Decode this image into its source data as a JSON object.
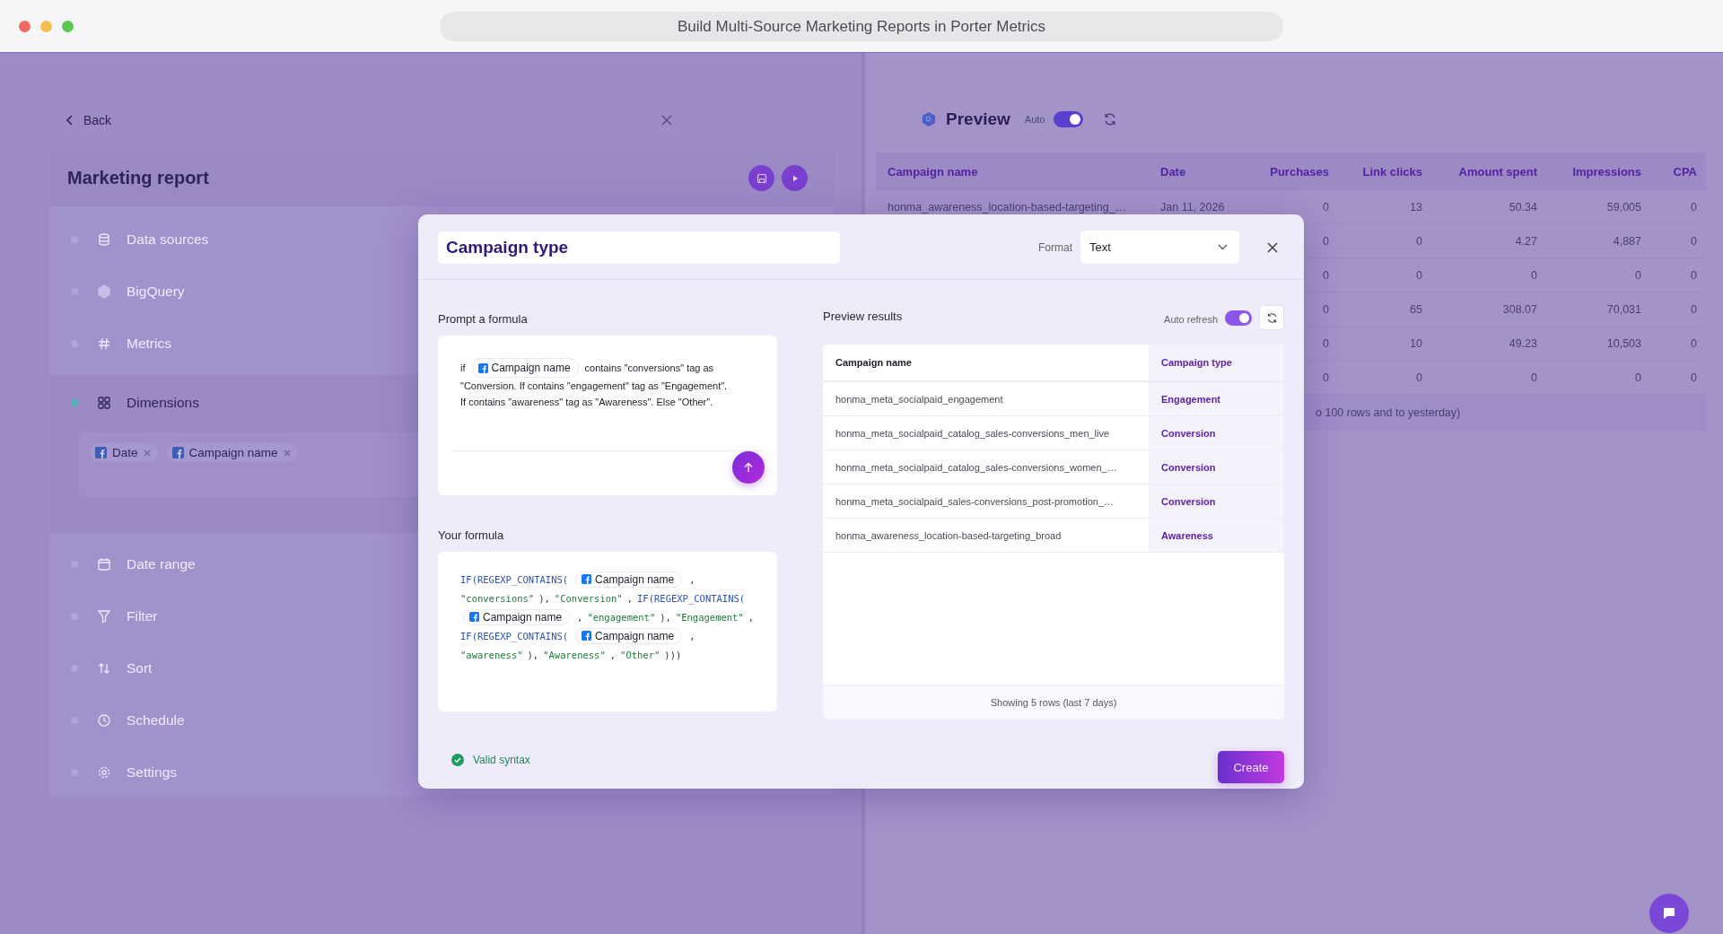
{
  "window": {
    "title": "Build Multi-Source Marketing Reports in Porter Metrics"
  },
  "builder": {
    "back": "Back",
    "title": "Marketing report",
    "steps": [
      {
        "label": "Data sources",
        "selected": false
      },
      {
        "label": "BigQuery",
        "selected": false
      },
      {
        "label": "Metrics",
        "selected": false
      },
      {
        "label": "Dimensions",
        "selected": true,
        "fields": [
          "Date",
          "Campaign name"
        ]
      },
      {
        "label": "Date range",
        "selected": false
      },
      {
        "label": "Filter",
        "selected": false
      },
      {
        "label": "Sort",
        "selected": false
      },
      {
        "label": "Schedule",
        "selected": false
      },
      {
        "label": "Settings",
        "selected": false
      }
    ]
  },
  "preview": {
    "title": "Preview",
    "auto_label": "Auto",
    "auto": {
      "on": true
    },
    "columns": [
      "Campaign name",
      "Date",
      "Purchases",
      "Link clicks",
      "Amount spent",
      "Impressions",
      "CPA"
    ],
    "rows": [
      {
        "cells": [
          "honma_awareness_location-based-targeting_…",
          "Jan 11, 2026",
          "0",
          "13",
          "50.34",
          "59,005",
          "0"
        ]
      },
      {
        "cells": [
          "0",
          "0",
          "4.27",
          "4,887",
          "0"
        ]
      },
      {
        "cells": [
          "0",
          "0",
          "0",
          "0",
          "0"
        ]
      },
      {
        "cells": [
          "0",
          "65",
          "308.07",
          "70,031",
          "0"
        ]
      },
      {
        "cells": [
          "0",
          "10",
          "49.23",
          "10,503",
          "0"
        ]
      },
      {
        "cells": [
          "0",
          "0",
          "0",
          "0",
          "0"
        ]
      }
    ],
    "footer": "o 100 rows and to yesterday)"
  },
  "modal": {
    "name": "Campaign type",
    "format_label": "Format",
    "format": "Text",
    "prompt_label": "Prompt a formula",
    "prompt": [
      [
        {
          "kind": "text",
          "text": "if"
        },
        {
          "kind": "field",
          "text": "Campaign name"
        },
        {
          "kind": "text",
          "text": "contains \"conversions\" tag as"
        }
      ],
      [
        {
          "kind": "text",
          "text": "\"Conversion. If contains \"engagement\" tag as \"Engagement\". If contains \"awareness\" tag as \"Awareness\". Else \"Other\"."
        }
      ]
    ],
    "formula_label": "Your formula",
    "formula": [
      [
        {
          "kind": "func",
          "text": "IF(REGEXP_CONTAINS("
        },
        {
          "kind": "field",
          "text": "Campaign name"
        },
        {
          "kind": "punct",
          "text": ","
        }
      ],
      [
        {
          "kind": "string",
          "text": "\"conversions\""
        },
        {
          "kind": "punct",
          "text": "),"
        },
        {
          "kind": "string",
          "text": "\"Conversion\""
        },
        {
          "kind": "punct",
          "text": ","
        },
        {
          "kind": "func",
          "text": "IF(REGEXP_CONTAINS("
        }
      ],
      [
        {
          "kind": "field",
          "text": "Campaign name"
        },
        {
          "kind": "punct",
          "text": ","
        },
        {
          "kind": "string",
          "text": "\"engagement\""
        },
        {
          "kind": "punct",
          "text": "),"
        },
        {
          "kind": "string",
          "text": "\"Engagement\""
        },
        {
          "kind": "punct",
          "text": ","
        }
      ],
      [
        {
          "kind": "func",
          "text": "IF(REGEXP_CONTAINS("
        },
        {
          "kind": "field",
          "text": "Campaign name"
        },
        {
          "kind": "punct",
          "text": ","
        }
      ],
      [
        {
          "kind": "string",
          "text": "\"awareness\""
        },
        {
          "kind": "punct",
          "text": "),"
        },
        {
          "kind": "string",
          "text": "\"Awareness\""
        },
        {
          "kind": "punct",
          "text": ","
        },
        {
          "kind": "string",
          "text": "\"Other\""
        },
        {
          "kind": "punct",
          "text": ")))"
        }
      ]
    ],
    "validity": {
      "valid": true,
      "text": "Valid syntax"
    },
    "results_label": "Preview results",
    "auto_refresh_label": "Auto refresh",
    "auto_refresh": {
      "on": true
    },
    "results_columns": [
      "Campaign name",
      "Campaign type"
    ],
    "results": [
      {
        "name": "honma_meta_socialpaid_engagement",
        "type": "Engagement"
      },
      {
        "name": "honma_meta_socialpaid_catalog_sales-conversions_men_live",
        "type": "Conversion"
      },
      {
        "name": "honma_meta_socialpaid_catalog_sales-conversions_women_…",
        "type": "Conversion"
      },
      {
        "name": "honma_meta_socialpaid_sales-conversions_post-promotion_…",
        "type": "Conversion"
      },
      {
        "name": "honma_awareness_location-based-targeting_broad",
        "type": "Awareness"
      }
    ],
    "results_footer": "Showing 5 rows (last 7 days)",
    "create": "Create"
  }
}
